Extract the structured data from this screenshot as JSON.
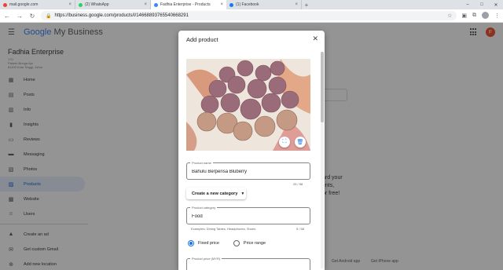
{
  "browser": {
    "tabs": [
      {
        "title": "mail.google.com",
        "color": "#ea4335"
      },
      {
        "title": "(2) WhatsApp",
        "color": "#25d366"
      },
      {
        "title": "Fadhia Enterprise - Products",
        "color": "#4285f4"
      },
      {
        "title": "(1) Facebook",
        "color": "#1877f2"
      }
    ],
    "url": "https://business.google.com/products/l/14668893765540668291"
  },
  "app": {
    "brand_google": "Google",
    "brand_rest": " My Business",
    "avatar_letter": "F"
  },
  "business": {
    "name": "Fadhia Enterprise",
    "addr_lines": [
      "170",
      "Pakem Bunga Api",
      "81100 Kota Tinggi, Johor"
    ]
  },
  "sidebar": {
    "items": [
      {
        "label": "Home",
        "icon": "home-icon"
      },
      {
        "label": "Posts",
        "icon": "posts-icon"
      },
      {
        "label": "Info",
        "icon": "info-icon"
      },
      {
        "label": "Insights",
        "icon": "insights-icon"
      },
      {
        "label": "Reviews",
        "icon": "reviews-icon"
      },
      {
        "label": "Messaging",
        "icon": "messaging-icon"
      },
      {
        "label": "Photos",
        "icon": "photos-icon"
      },
      {
        "label": "Products",
        "icon": "products-icon",
        "active": true
      },
      {
        "label": "Website",
        "icon": "website-icon"
      },
      {
        "label": "Users",
        "icon": "users-icon"
      },
      {
        "label": "Create an ad",
        "icon": "ads-icon"
      },
      {
        "label": "Get custom Gmail",
        "icon": "gmail-icon"
      },
      {
        "label": "Add new location",
        "icon": "add-location-icon"
      }
    ]
  },
  "background": {
    "text_right_1": "ard your",
    "text_right_2": "ents,",
    "text_right_3": "or free!",
    "footer_android": "Get Android app",
    "footer_iphone": "Get iPhone app"
  },
  "dialog": {
    "title": "Add product",
    "product_name_label": "Product name",
    "product_name_value": "Bahulu Berperisa Bluberry",
    "product_name_counter": "25 / 58",
    "category_button": "Create a new category",
    "category_label": "Product category",
    "category_value": "Food",
    "category_helper": "Examples: Dining Tables, Headphones, Shoes",
    "category_counter": "5 / 58",
    "price_options": [
      "Fixed price",
      "Price range"
    ],
    "price_selected": "Fixed price",
    "price_label": "Product price (MYR)"
  }
}
